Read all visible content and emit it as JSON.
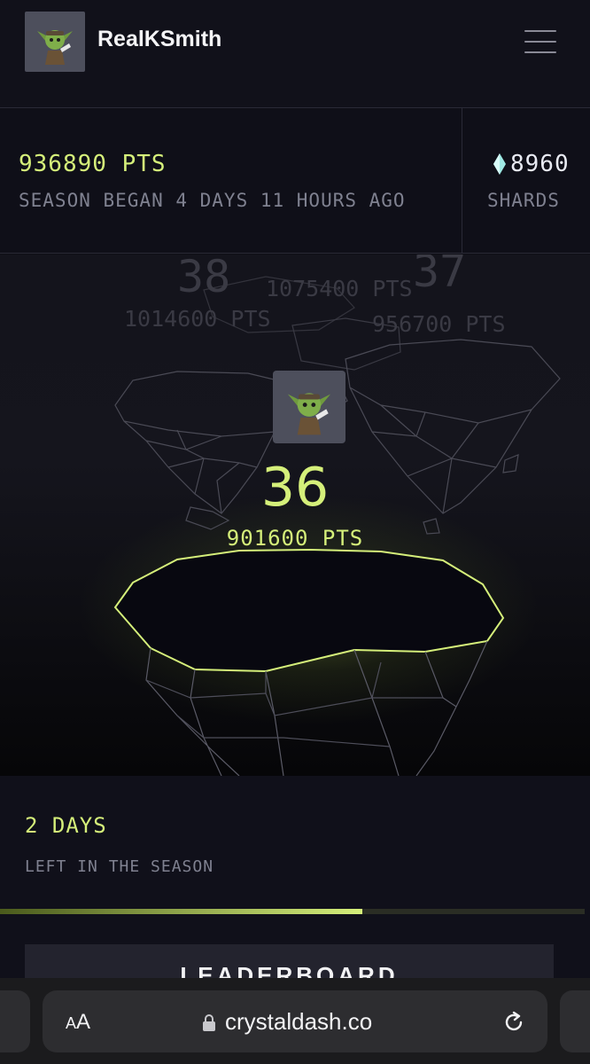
{
  "header": {
    "username": "RealKSmith",
    "avatar_icon": "goblin-avatar-icon",
    "menu_icon": "hamburger-menu-icon"
  },
  "stats": {
    "points": "936890 PTS",
    "season_began": "SEASON BEGAN 4 DAYS 11 HOURS AGO",
    "shards_value": "8960",
    "shards_label": "SHARDS",
    "shards_icon": "crystal-icon"
  },
  "scene": {
    "others": [
      {
        "rank": "38",
        "points": "1014600 PTS"
      },
      {
        "rank": "37",
        "points": "956700 PTS"
      },
      {
        "rank": "37",
        "points": "1075400 PTS"
      }
    ],
    "player": {
      "rank": "36",
      "points": "901600 PTS"
    }
  },
  "season": {
    "days_left": "2 DAYS",
    "left_label": "LEFT IN THE SEASON",
    "progress": 0.62
  },
  "leaderboard": {
    "label": "LEADERBOARD"
  },
  "browser": {
    "aa_small": "A",
    "aa_big": "A",
    "url": "crystaldash.co",
    "lock_icon": "lock-icon",
    "reload_icon": "reload-icon"
  },
  "colors": {
    "accent": "#d5ef7a",
    "background": "#0e0e16",
    "muted": "#7f8190"
  }
}
